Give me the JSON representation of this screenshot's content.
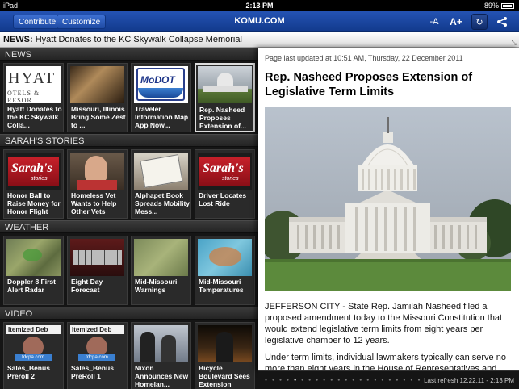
{
  "status": {
    "device": "iPad",
    "time": "2:13 PM",
    "battery": "89%"
  },
  "nav": {
    "contribute": "Contribute",
    "customize": "Customize",
    "title": "KOMU.COM",
    "font_smaller": "-A",
    "font_larger": "A+",
    "refresh_icon": "↻",
    "share_icon": "≺"
  },
  "ticker": {
    "label": "NEWS:",
    "headline": "Hyatt Donates to the KC Skywalk Collapse Memorial"
  },
  "sections": [
    {
      "title": "NEWS",
      "items": [
        {
          "caption": "Hyatt Donates to the KC Skywalk Colla...",
          "thumb_text": "HYAT",
          "thumb_sub": "OTELS & RESOR"
        },
        {
          "caption": "Missouri, Illinois Bring Some Zest to ..."
        },
        {
          "caption": "Traveler Information Map App Now...",
          "thumb_text": "MoDOT"
        },
        {
          "caption": "Rep. Nasheed Proposes Extension of..."
        }
      ]
    },
    {
      "title": "SARAH'S STORIES",
      "items": [
        {
          "caption": "Honor Ball to Raise Money for Honor Flight",
          "thumb_text": "Sarah's",
          "thumb_sub": "stories"
        },
        {
          "caption": "Homeless Vet Wants to Help Other Vets"
        },
        {
          "caption": "Alphapet Book Spreads Mobility Mess..."
        },
        {
          "caption": "Driver Locates Lost Ride",
          "thumb_text": "Sarah's",
          "thumb_sub": "stories"
        }
      ]
    },
    {
      "title": "WEATHER",
      "items": [
        {
          "caption": "Doppler 8 First Alert Radar"
        },
        {
          "caption": "Eight Day Forecast"
        },
        {
          "caption": "Mid-Missouri Warnings"
        },
        {
          "caption": "Mid-Missouri Temperatures"
        }
      ]
    },
    {
      "title": "VIDEO",
      "items": [
        {
          "caption": "Sales_Benus Preroll 2",
          "thumb_text": "Itemized  Deb",
          "thumb_sub": "tdcpa.com"
        },
        {
          "caption": "Sales_Benus PreRoll 1",
          "thumb_text": "Itemized  Deb",
          "thumb_sub": "tdcpa.com"
        },
        {
          "caption": "Nixon Announces New Homelan..."
        },
        {
          "caption": "Bicycle Boulevard Sees Extension"
        }
      ]
    }
  ],
  "article": {
    "updated": "Page last updated at 10:51 AM, Thursday, 22 December 2011",
    "title": "Rep. Nasheed Proposes Extension of Legislative Term Limits",
    "para1": "JEFFERSON CITY - State Rep. Jamilah Nasheed filed a proposed amendment today to the Missouri Constitution that would extend legislative term limits from eight years per legislative chamber to 12 years.",
    "para2": "Under term limits, individual lawmakers typically can serve no more than eight years in the House of Representatives and"
  },
  "footer": {
    "last_refresh": "Last refresh 12.22.11 - 2:13 PM"
  }
}
